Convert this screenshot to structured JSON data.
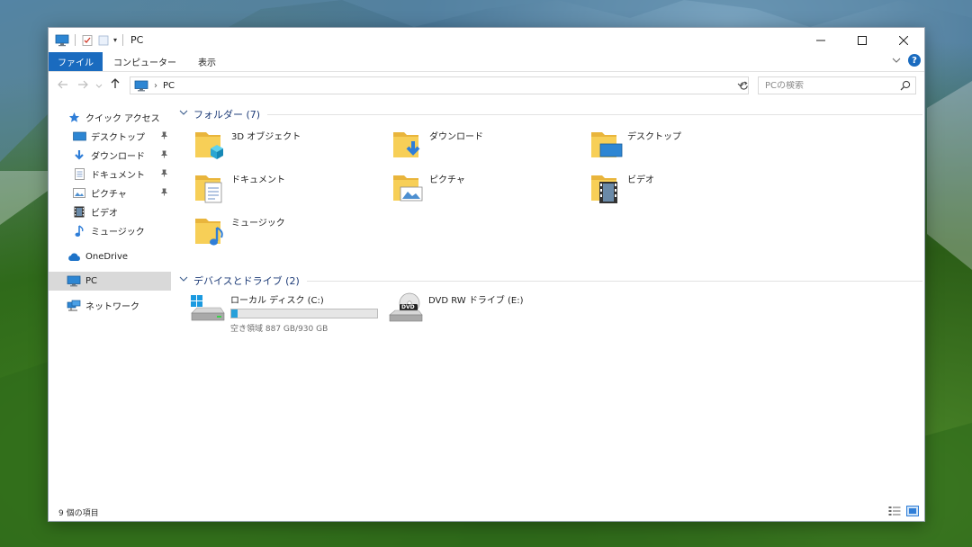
{
  "window": {
    "title": "PC"
  },
  "ribbon": {
    "tabs": [
      "ファイル",
      "コンピューター",
      "表示"
    ]
  },
  "address": {
    "path": "PC"
  },
  "search": {
    "placeholder": "PCの検索"
  },
  "nav": {
    "quick_access": "クイック アクセス",
    "quick_items": [
      "デスクトップ",
      "ダウンロード",
      "ドキュメント",
      "ピクチャ",
      "ビデオ",
      "ミュージック"
    ],
    "onedrive": "OneDrive",
    "pc": "PC",
    "network": "ネットワーク"
  },
  "folders": {
    "header": "フォルダー (7)",
    "items": [
      "3D オブジェクト",
      "ダウンロード",
      "デスクトップ",
      "ドキュメント",
      "ピクチャ",
      "ビデオ",
      "ミュージック"
    ]
  },
  "drives": {
    "header": "デバイスとドライブ (2)",
    "local": {
      "name": "ローカル ディスク (C:)",
      "free": "空き領域 887 GB/930 GB",
      "used_fraction": 0.046
    },
    "dvd": {
      "name": "DVD RW ドライブ (E:)",
      "badge": "DVD"
    }
  },
  "status": {
    "count": "9 個の項目"
  },
  "colors": {
    "accent": "#1a6bbf",
    "folder": "#f5c849",
    "drive_bar": "#26a0da",
    "group_header": "#1e3c78"
  }
}
